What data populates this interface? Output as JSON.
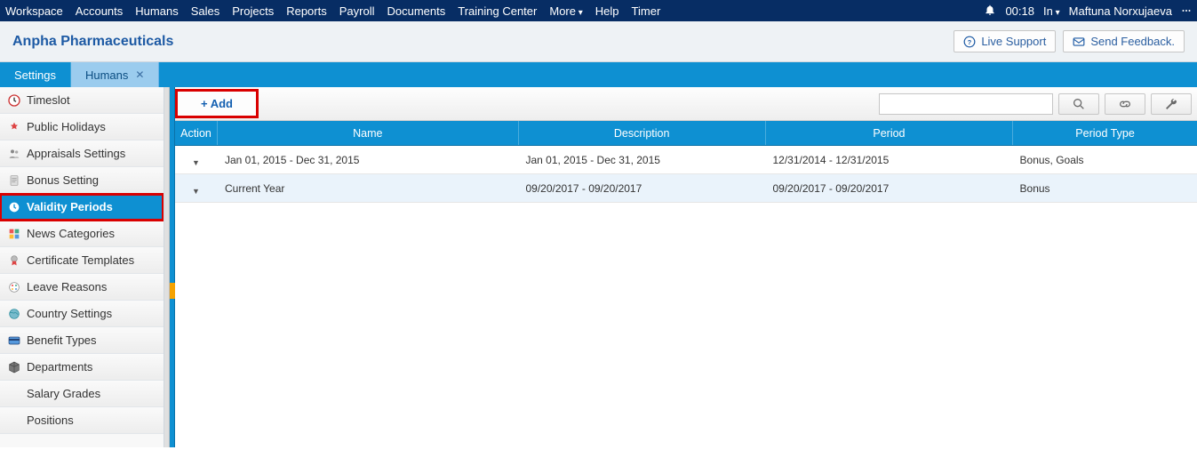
{
  "topnav": {
    "items": [
      "Workspace",
      "Accounts",
      "Humans",
      "Sales",
      "Projects",
      "Reports",
      "Payroll",
      "Documents",
      "Training Center",
      "More",
      "Help",
      "Timer"
    ],
    "more_index": 9,
    "time": "00:18",
    "status": "In",
    "user": "Maftuna Norxujaeva"
  },
  "header": {
    "company": "Anpha Pharmaceuticals",
    "live_support": "Live Support",
    "send_feedback": "Send Feedback."
  },
  "tabs": {
    "settings": "Settings",
    "humans": "Humans"
  },
  "sidebar": {
    "items": [
      {
        "label": "Timeslot",
        "icon": "clock"
      },
      {
        "label": "Public Holidays",
        "icon": "holidays"
      },
      {
        "label": "Appraisals Settings",
        "icon": "people"
      },
      {
        "label": "Bonus Setting",
        "icon": "doc"
      },
      {
        "label": "Validity Periods",
        "icon": "clock2",
        "active": true,
        "hl": true
      },
      {
        "label": "News Categories",
        "icon": "grid"
      },
      {
        "label": "Certificate Templates",
        "icon": "badge"
      },
      {
        "label": "Leave Reasons",
        "icon": "paint"
      },
      {
        "label": "Country Settings",
        "icon": "globe"
      },
      {
        "label": "Benefit Types",
        "icon": "card"
      },
      {
        "label": "Departments",
        "icon": "cube"
      },
      {
        "label": "Salary Grades",
        "sub": true
      },
      {
        "label": "Positions",
        "sub": true
      }
    ]
  },
  "toolbar": {
    "add_label": "+ Add",
    "search_placeholder": ""
  },
  "table": {
    "headers": {
      "action": "Action",
      "name": "Name",
      "desc": "Description",
      "period": "Period",
      "ptype": "Period Type"
    },
    "rows": [
      {
        "name": "Jan 01, 2015 - Dec 31, 2015",
        "desc": "Jan 01, 2015 - Dec 31, 2015",
        "period": "12/31/2014 - 12/31/2015",
        "ptype": "Bonus, Goals"
      },
      {
        "name": "Current Year",
        "desc": "09/20/2017 - 09/20/2017",
        "period": "09/20/2017 - 09/20/2017",
        "ptype": "Bonus"
      }
    ]
  }
}
